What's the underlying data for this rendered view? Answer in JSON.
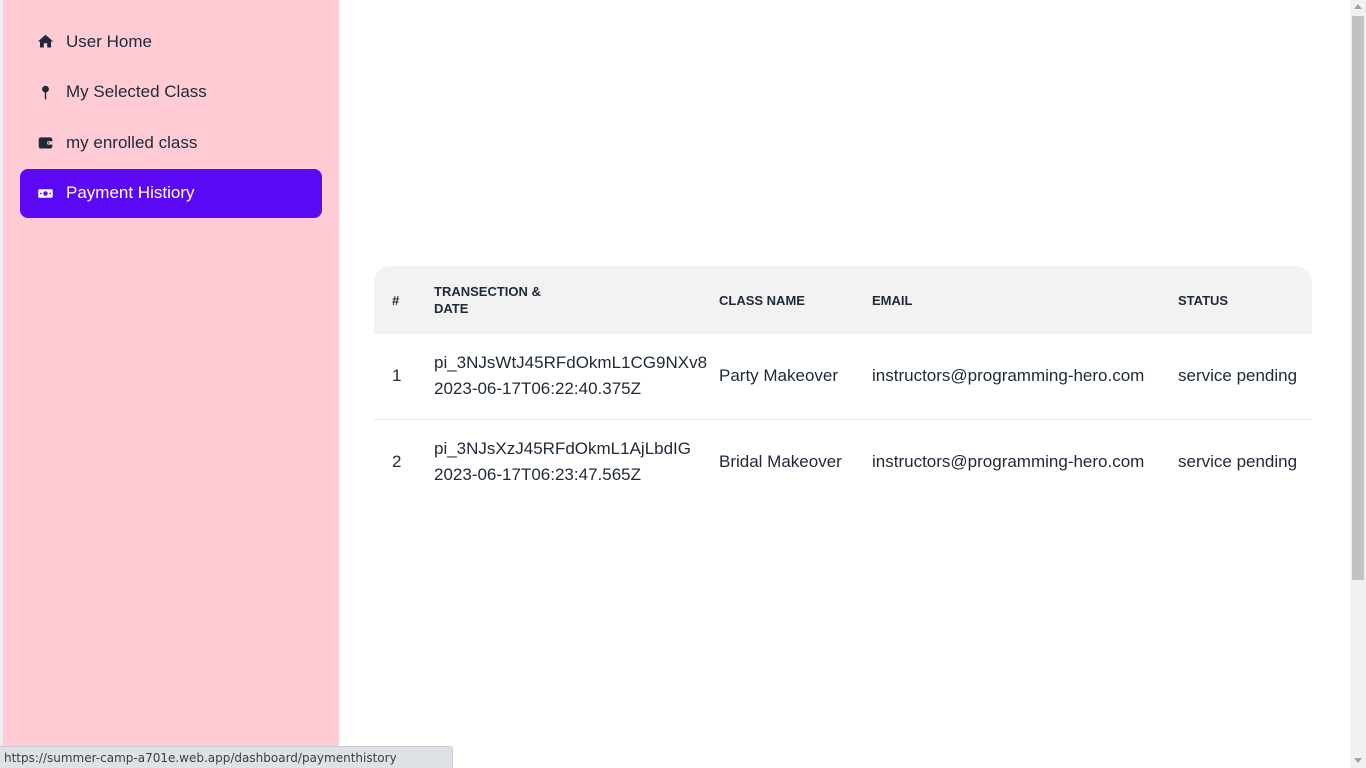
{
  "sidebar": {
    "items": [
      {
        "label": "User Home",
        "icon": "home-icon",
        "active": false
      },
      {
        "label": "My Selected Class",
        "icon": "pin-icon",
        "active": false
      },
      {
        "label": "my enrolled class",
        "icon": "wallet-icon",
        "active": false
      },
      {
        "label": "Payment Histiory",
        "icon": "money-icon",
        "active": true
      }
    ],
    "accent_color": "#5b09f5",
    "background_color": "#ffccd5"
  },
  "table": {
    "headers": {
      "index": "#",
      "transaction_line1": "TRANSECTION &",
      "transaction_line2": "DATE",
      "class_name": "CLASS NAME",
      "email": "EMAIL",
      "status": "STATUS"
    },
    "rows": [
      {
        "index": "1",
        "transaction_id": "pi_3NJsWtJ45RFdOkmL1CG9NXv8",
        "date": "2023-06-17T06:22:40.375Z",
        "class_name": "Party Makeover",
        "email": "instructors@programming-hero.com",
        "status": "service pending"
      },
      {
        "index": "2",
        "transaction_id": "pi_3NJsXzJ45RFdOkmL1AjLbdIG",
        "date": "2023-06-17T06:23:47.565Z",
        "class_name": "Bridal Makeover",
        "email": "instructors@programming-hero.com",
        "status": "service pending"
      }
    ]
  },
  "status_bar": {
    "url": "https://summer-camp-a701e.web.app/dashboard/paymenthistory"
  }
}
